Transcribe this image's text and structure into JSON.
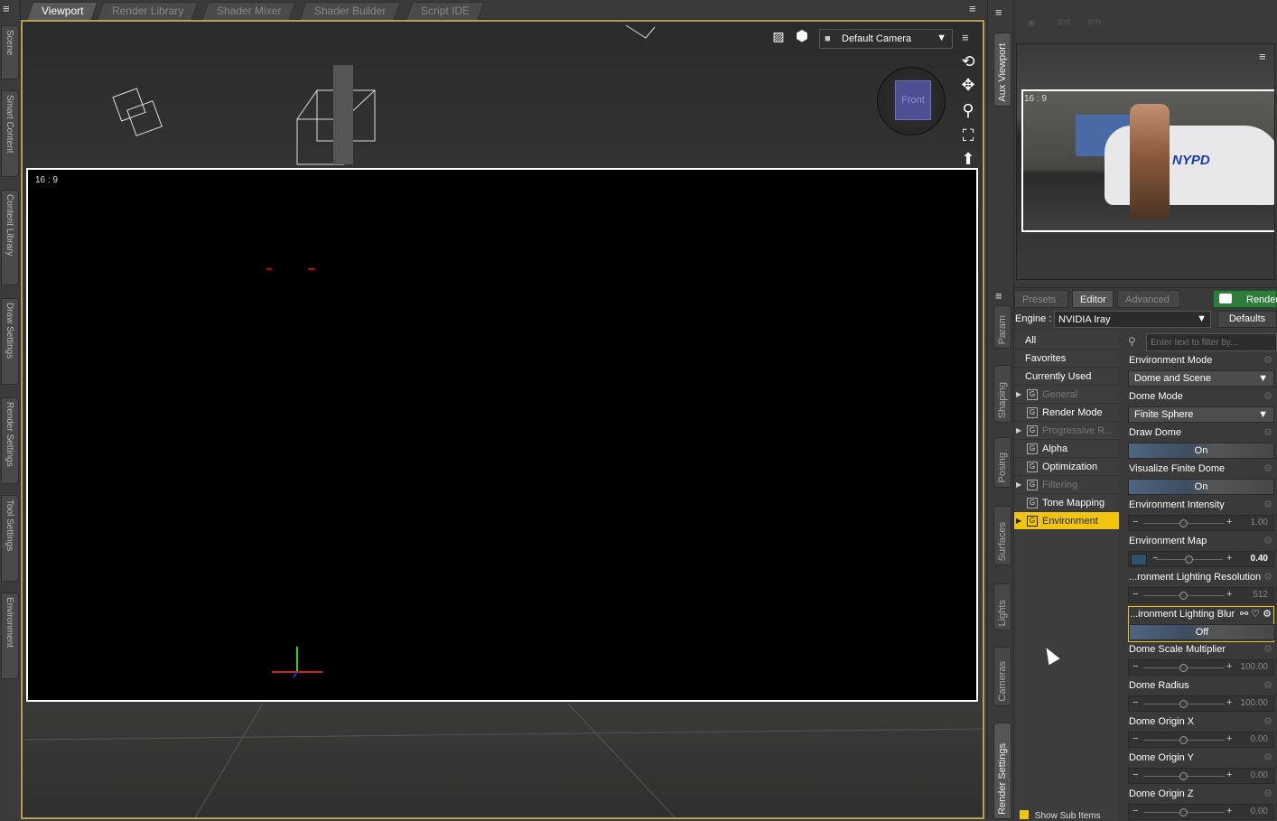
{
  "left_dock": {
    "tabs": [
      "Scene",
      "Smart Content",
      "Content Library",
      "Draw Settings",
      "Render Settings",
      "Tool Settings",
      "Environment"
    ]
  },
  "viewport_tabs": [
    {
      "label": "Viewport",
      "active": true
    },
    {
      "label": "Render Library",
      "active": false
    },
    {
      "label": "Shader Mixer",
      "active": false
    },
    {
      "label": "Shader Builder",
      "active": false
    },
    {
      "label": "Script IDE",
      "active": false
    }
  ],
  "viewport": {
    "aspect_label": "16 : 9",
    "camera": "Default Camera",
    "cube_face": "Front",
    "icons": [
      "orbit-icon",
      "pan-icon",
      "zoom-icon",
      "frame-icon",
      "home-icon"
    ]
  },
  "right_strip": {
    "tabs": [
      "Aux Viewport",
      "Param",
      "Shaping",
      "Posing",
      "Surfaces",
      "Lights",
      "Cameras",
      "Render Settings"
    ]
  },
  "aux_viewport": {
    "ratio_label": "16 : 9",
    "toolbar": [
      "IPR",
      "IPR"
    ],
    "car_text": "NYPD"
  },
  "render_settings": {
    "tabs": [
      {
        "label": "Presets",
        "active": false
      },
      {
        "label": "Editor",
        "active": true
      },
      {
        "label": "Advanced",
        "active": false
      }
    ],
    "render_button": "Render",
    "engine_label": "Engine :",
    "engine_value": "NVIDIA Iray",
    "defaults_button": "Defaults",
    "filter_placeholder": "Enter text to filter by...",
    "groups": [
      {
        "label": "All",
        "type": "plain"
      },
      {
        "label": "Favorites",
        "type": "plain"
      },
      {
        "label": "Currently Used",
        "type": "plain"
      },
      {
        "label": "General",
        "type": "group",
        "expand": true,
        "dim": true
      },
      {
        "label": "Render Mode",
        "type": "group",
        "expand": false,
        "dim": false
      },
      {
        "label": "Progressive R...",
        "type": "group",
        "expand": true,
        "dim": true
      },
      {
        "label": "Alpha",
        "type": "group",
        "expand": false,
        "dim": false
      },
      {
        "label": "Optimization",
        "type": "group",
        "expand": false,
        "dim": false
      },
      {
        "label": "Filtering",
        "type": "group",
        "expand": true,
        "dim": true
      },
      {
        "label": "Tone Mapping",
        "type": "group",
        "expand": false,
        "dim": false
      },
      {
        "label": "Environment",
        "type": "group",
        "expand": true,
        "dim": false,
        "selected": true
      }
    ],
    "group_badge": "G",
    "show_sub_items": "Show Sub Items",
    "properties": [
      {
        "label": "Environment Mode",
        "kind": "dropdown",
        "value": "Dome and Scene"
      },
      {
        "label": "Dome Mode",
        "kind": "dropdown",
        "value": "Finite Sphere"
      },
      {
        "label": "Draw Dome",
        "kind": "toggle",
        "value": "On"
      },
      {
        "label": "Visualize Finite Dome",
        "kind": "toggle",
        "value": "On"
      },
      {
        "label": "Environment Intensity",
        "kind": "slider",
        "value": "1.00",
        "pos": 0.5
      },
      {
        "label": "Environment Map",
        "kind": "swatch",
        "value": "0.40",
        "pos": 0.5
      },
      {
        "label": "...ronment Lighting Resolution",
        "kind": "slider",
        "value": "512",
        "pos": 0.5
      },
      {
        "label": "...ironment Lighting Blur",
        "kind": "toggle",
        "value": "Off",
        "highlight": true
      },
      {
        "label": "Dome Scale Multiplier",
        "kind": "slider",
        "value": "100.00",
        "pos": 0.5
      },
      {
        "label": "Dome Radius",
        "kind": "slider",
        "value": "100.00",
        "pos": 0.5
      },
      {
        "label": "Dome Origin X",
        "kind": "slider",
        "value": "0.00",
        "pos": 0.5
      },
      {
        "label": "Dome Origin Y",
        "kind": "slider",
        "value": "0.00",
        "pos": 0.5
      },
      {
        "label": "Dome Origin Z",
        "kind": "slider",
        "value": "0.00",
        "pos": 0.5
      }
    ]
  },
  "colors": {
    "selection": "#f1c40f",
    "render_green": "#2f7d3c",
    "viewport_border": "#b8a25a"
  }
}
